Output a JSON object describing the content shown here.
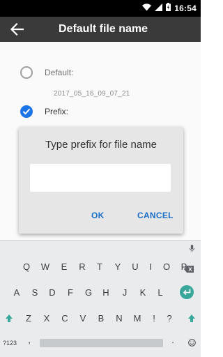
{
  "status_bar": {
    "time": "16:54",
    "icons": [
      "wifi-icon",
      "signal-icon",
      "battery-icon"
    ]
  },
  "app_bar": {
    "title": "Default file name",
    "back_icon": "arrow-left-icon"
  },
  "options": {
    "default_label": "Default:",
    "default_value": "2017_05_16_09_07_21",
    "prefix_label": "Prefix:",
    "selected": "prefix"
  },
  "dialog": {
    "title": "Type prefix for file name",
    "input_value": "",
    "ok_label": "OK",
    "cancel_label": "CANCEL"
  },
  "keyboard": {
    "row1": [
      "Q",
      "W",
      "E",
      "R",
      "T",
      "Y",
      "U",
      "I",
      "O",
      "P"
    ],
    "row2": [
      "A",
      "S",
      "D",
      "F",
      "G",
      "H",
      "J",
      "K",
      "L"
    ],
    "row3": [
      "Z",
      "X",
      "C",
      "V",
      "B",
      "N",
      "M",
      "!",
      "?"
    ],
    "row4": {
      "symbols": "?123",
      "comma": ",",
      "period": "."
    }
  },
  "colors": {
    "accent": "#1b74e8",
    "appbar": "#3a3a3a",
    "enter_key": "#3aa79b",
    "button_text": "#1b6fc7"
  }
}
